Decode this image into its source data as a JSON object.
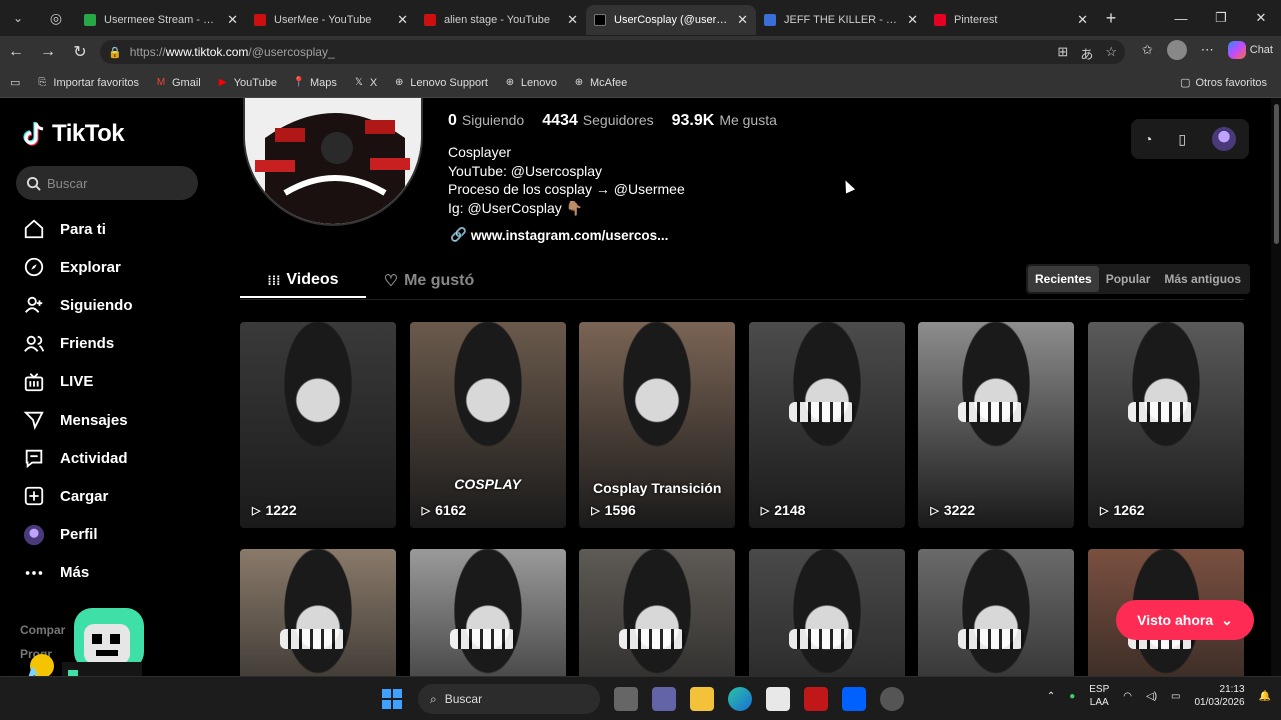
{
  "browser": {
    "tabs": [
      {
        "title": "Usermeee Stream - Watc",
        "color": "#27a745",
        "active": false
      },
      {
        "title": "UserMee - YouTube",
        "color": "#cc1010",
        "active": false
      },
      {
        "title": "alien stage - YouTube",
        "color": "#cc1010",
        "active": false
      },
      {
        "title": "UserCosplay (@usercospl",
        "color": "#000000",
        "active": true
      },
      {
        "title": "JEFF THE KILLER - Búsque",
        "color": "#3a6fd8",
        "active": false
      },
      {
        "title": "Pinterest",
        "color": "#e60023",
        "active": false
      }
    ],
    "url_scheme": "https://",
    "url_host": "www.tiktok.com",
    "url_path": "/@usercosplay_",
    "chat_label": "Chat",
    "favorites": [
      {
        "label": "Importar favoritos",
        "icon": "import-icon"
      },
      {
        "label": "Gmail",
        "icon": "gmail-icon"
      },
      {
        "label": "YouTube",
        "icon": "youtube-icon"
      },
      {
        "label": "Maps",
        "icon": "maps-icon"
      },
      {
        "label": "X",
        "icon": "x-icon"
      },
      {
        "label": "Lenovo Support",
        "icon": "globe-icon"
      },
      {
        "label": "Lenovo",
        "icon": "globe-icon"
      },
      {
        "label": "McAfee",
        "icon": "globe-icon"
      }
    ],
    "other_favorites": "Otros favoritos"
  },
  "tiktok": {
    "logo": "TikTok",
    "search_placeholder": "Buscar",
    "nav": [
      {
        "label": "Para ti",
        "icon": "home-icon"
      },
      {
        "label": "Explorar",
        "icon": "compass-icon"
      },
      {
        "label": "Siguiendo",
        "icon": "following-icon"
      },
      {
        "label": "Friends",
        "icon": "friends-icon"
      },
      {
        "label": "LIVE",
        "icon": "live-icon"
      },
      {
        "label": "Mensajes",
        "icon": "messages-icon"
      },
      {
        "label": "Actividad",
        "icon": "activity-icon"
      },
      {
        "label": "Cargar",
        "icon": "upload-icon"
      },
      {
        "label": "Perfil",
        "icon": "profile-avatar-icon"
      },
      {
        "label": "Más",
        "icon": "more-icon"
      }
    ],
    "footer_1": "Compar",
    "footer_2": "Progr",
    "profile": {
      "following_count": "0",
      "following_label": "Siguiendo",
      "followers_count": "4434",
      "followers_label": "Seguidores",
      "likes_count": "93.9K",
      "likes_label": "Me gusta",
      "bio_lines": [
        "Cosplayer",
        "YouTube: @Usercosplay",
        "Proceso de los cosplay → @Usermee",
        "Ig: @UserCosplay 👇🏽"
      ],
      "link": "www.instagram.com/usercos..."
    },
    "tabs": {
      "videos": "Videos",
      "liked": "Me gustó"
    },
    "sort": [
      "Recientes",
      "Popular",
      "Más antiguos"
    ],
    "videos": [
      {
        "views": "1222",
        "caption": "",
        "bg": "#3a3a3a"
      },
      {
        "views": "6162",
        "caption": "COSPLAY",
        "bg": "#6b5a4c"
      },
      {
        "views": "1596",
        "caption": "Cosplay Transición",
        "bg": "#7a6455"
      },
      {
        "views": "2148",
        "caption": "",
        "bg": "#4c4c4c"
      },
      {
        "views": "3222",
        "caption": "",
        "bg": "#8d8d8d"
      },
      {
        "views": "1262",
        "caption": "",
        "bg": "#5a5a5a"
      },
      {
        "views": "",
        "caption": "",
        "bg": "#8a7a6a"
      },
      {
        "views": "",
        "caption": "",
        "bg": "#9a9a9a"
      },
      {
        "views": "",
        "caption": "",
        "bg": "#5e5a55"
      },
      {
        "views": "",
        "caption": "",
        "bg": "#4a4a4a"
      },
      {
        "views": "",
        "caption": "",
        "bg": "#6a6a6a"
      },
      {
        "views": "",
        "caption": "",
        "bg": "#7a5040"
      }
    ],
    "visto_ahora": "Visto ahora"
  },
  "taskbar": {
    "search": "Buscar",
    "lang_1": "ESP",
    "lang_2": "LAA",
    "time": "21:13",
    "date": "01/03/2026"
  }
}
